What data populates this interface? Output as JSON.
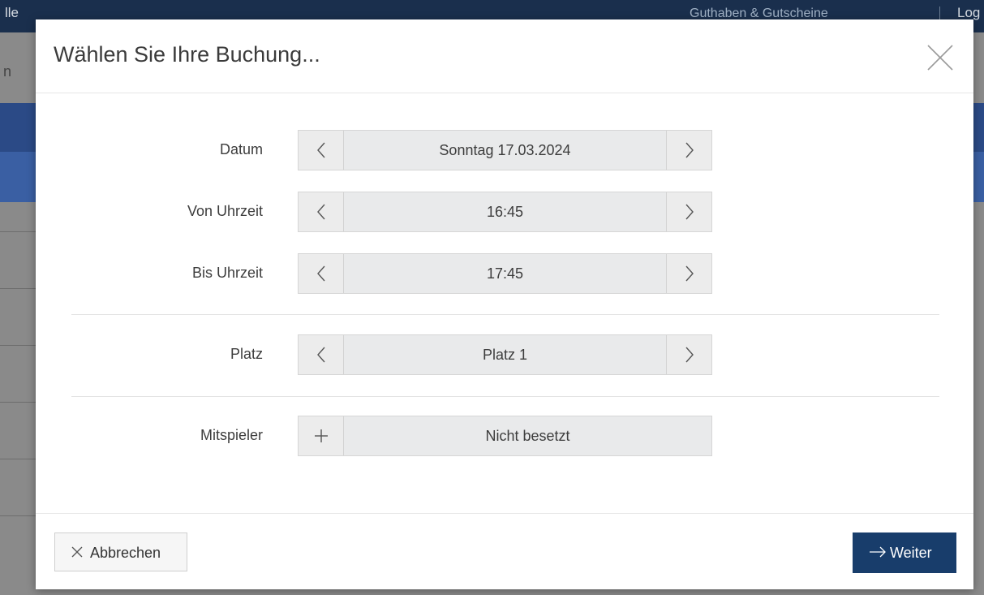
{
  "background": {
    "topbar_left": "lle",
    "topbar_middle": "Guthaben & Gutscheine",
    "topbar_right": "Log",
    "left_fragment": "n"
  },
  "modal": {
    "title": "Wählen Sie Ihre Buchung...",
    "fields": {
      "datum": {
        "label": "Datum",
        "value": "Sonntag 17.03.2024"
      },
      "von": {
        "label": "Von Uhrzeit",
        "value": "16:45"
      },
      "bis": {
        "label": "Bis Uhrzeit",
        "value": "17:45"
      },
      "platz": {
        "label": "Platz",
        "value": "Platz 1"
      },
      "mitspieler": {
        "label": "Mitspieler",
        "value": "Nicht besetzt"
      }
    },
    "footer": {
      "cancel_label": "Abbrechen",
      "next_label": "Weiter"
    }
  },
  "colors": {
    "primary_button": "#183d6b",
    "navbar": "#1a2f4d"
  }
}
